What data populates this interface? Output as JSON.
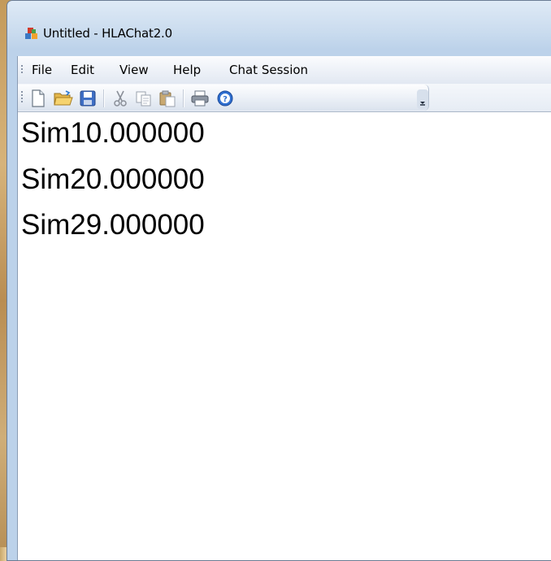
{
  "window": {
    "title": "Untitled - HLAChat2.0"
  },
  "menubar": {
    "items": [
      "File",
      "Edit",
      "View",
      "Help",
      "Chat Session"
    ]
  },
  "toolbar": {
    "buttons": [
      "new-icon",
      "open-icon",
      "save-icon",
      "cut-icon",
      "copy-icon",
      "paste-icon",
      "print-icon",
      "help-icon"
    ]
  },
  "editor": {
    "lines": [
      "Sim10.000000",
      "Sim20.000000",
      "Sim29.000000"
    ]
  }
}
